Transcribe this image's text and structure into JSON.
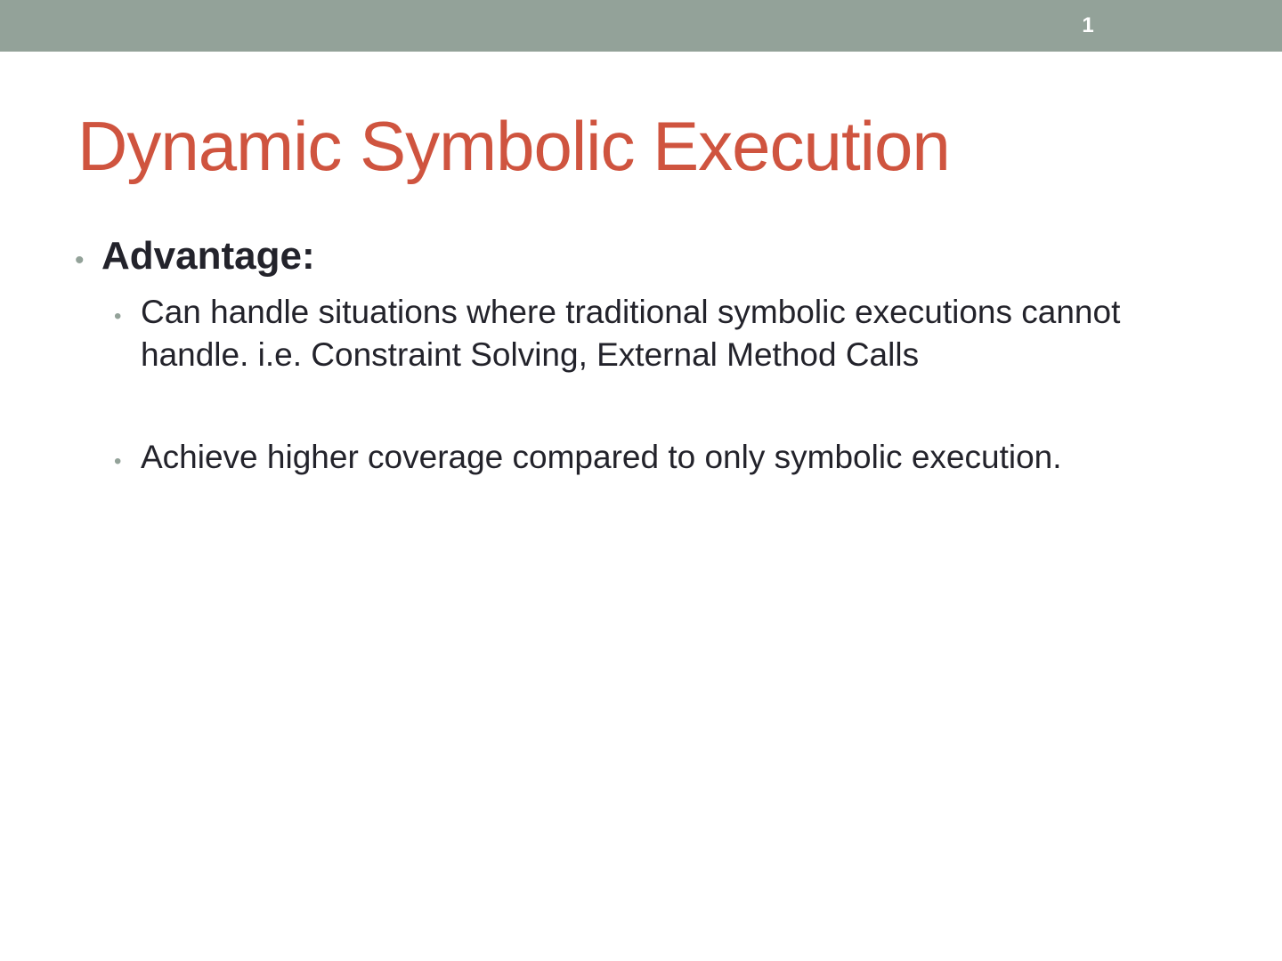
{
  "slide": {
    "number": "1",
    "title": "Dynamic Symbolic Execution",
    "bullets": [
      {
        "text": "Advantage:",
        "sub_bullets": [
          "Can handle situations where traditional symbolic executions cannot handle. i.e. Constraint Solving, External Method Calls",
          "Achieve higher coverage compared to only symbolic execution."
        ]
      }
    ],
    "bullet_glyph": "•"
  },
  "colors": {
    "header_bar": "#93a299",
    "title": "#cf543f",
    "body_text": "#23232b",
    "bullet": "#93a299"
  }
}
